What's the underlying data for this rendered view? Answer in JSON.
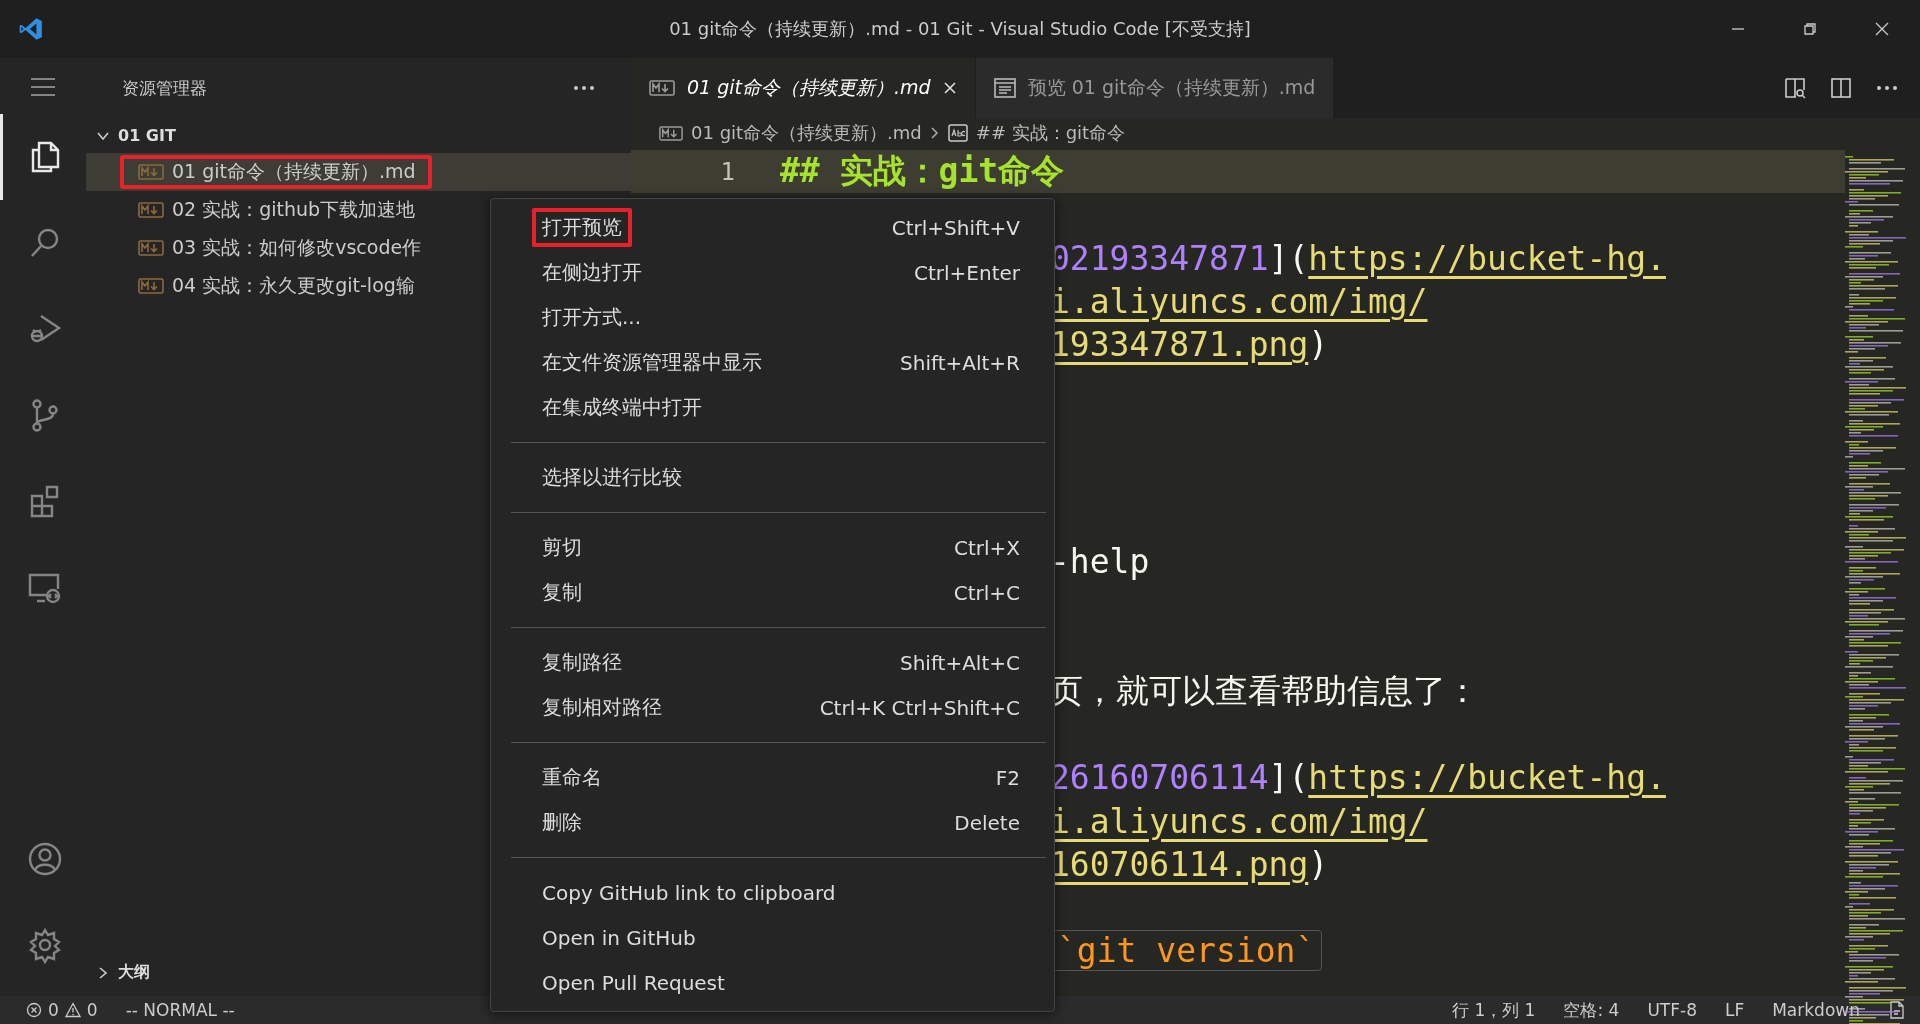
{
  "window": {
    "title": "01 git命令（持续更新）.md - 01 Git - Visual Studio Code [不受支持]"
  },
  "activity_bar": {
    "top": [
      {
        "kind": "files",
        "selected": true
      },
      {
        "kind": "search",
        "selected": false
      },
      {
        "kind": "debug",
        "selected": false
      },
      {
        "kind": "source-control",
        "selected": false
      },
      {
        "kind": "extensions",
        "selected": false
      },
      {
        "kind": "remote",
        "selected": false
      }
    ],
    "bottom": [
      {
        "kind": "account",
        "selected": false
      },
      {
        "kind": "settings",
        "selected": false
      }
    ]
  },
  "sidebar": {
    "title": "资源管理器",
    "folder": {
      "name": "01 GIT",
      "expanded": true
    },
    "files": [
      {
        "name": "01 git命令（持续更新）.md",
        "selected": true,
        "marked": true
      },
      {
        "name": "02 实战：github下载加速地",
        "selected": false,
        "marked": false
      },
      {
        "name": "03 实战：如何修改vscode作",
        "selected": false,
        "marked": false
      },
      {
        "name": "04 实战：永久更改git-log输",
        "selected": false,
        "marked": false
      }
    ],
    "outline": {
      "name": "大纲",
      "expanded": false
    }
  },
  "tabs": [
    {
      "label": "01 git命令（持续更新）.md",
      "kind": "markdown",
      "selected": true
    },
    {
      "label": "预览 01 git命令（持续更新）.md",
      "kind": "preview",
      "selected": false
    }
  ],
  "breadcrumb": [
    {
      "label": "01 git命令（持续更新）.md",
      "kind": "file"
    },
    {
      "label": "## 实战：git命令",
      "kind": "heading"
    }
  ],
  "editor": {
    "lines": [
      {
        "number": "1",
        "kind": "heading",
        "current": true,
        "segments": [
          {
            "kind": "heading",
            "text": "## 实战：git命令"
          }
        ]
      },
      {
        "kind": "blank"
      },
      {
        "kind": "text",
        "segments": [
          {
            "kind": "number",
            "text": "02193347871"
          },
          {
            "kind": "punct",
            "text": "]("
          },
          {
            "kind": "link",
            "text": "https://bucket-hg."
          }
        ]
      },
      {
        "kind": "text",
        "segments": [
          {
            "kind": "link",
            "text": "i.aliyuncs.com/img/"
          }
        ]
      },
      {
        "kind": "text",
        "segments": [
          {
            "kind": "link",
            "text": "193347871.png"
          },
          {
            "kind": "punct",
            "text": ")"
          }
        ]
      },
      {
        "kind": "blank"
      },
      {
        "kind": "blank"
      },
      {
        "kind": "blank"
      },
      {
        "kind": "blank"
      },
      {
        "kind": "text",
        "segments": [
          {
            "kind": "plain",
            "text": "-help"
          }
        ]
      },
      {
        "kind": "blank"
      },
      {
        "kind": "blank"
      },
      {
        "kind": "text",
        "segments": [
          {
            "kind": "prose",
            "text": "页，就可以查看帮助信息了："
          }
        ]
      },
      {
        "kind": "blank"
      },
      {
        "kind": "text",
        "segments": [
          {
            "kind": "number",
            "text": "26160706114"
          },
          {
            "kind": "punct",
            "text": "]("
          },
          {
            "kind": "link",
            "text": "https://bucket-hg."
          }
        ]
      },
      {
        "kind": "text",
        "segments": [
          {
            "kind": "link",
            "text": "i.aliyuncs.com/img/"
          }
        ]
      },
      {
        "kind": "text",
        "segments": [
          {
            "kind": "link",
            "text": "160706114.png"
          },
          {
            "kind": "punct",
            "text": ")"
          }
        ]
      },
      {
        "kind": "blank"
      },
      {
        "kind": "text",
        "segments": [
          {
            "kind": "code",
            "text": "`git version`"
          }
        ]
      }
    ]
  },
  "context_menu": {
    "groups": [
      [
        {
          "label": "打开预览",
          "shortcut": "Ctrl+Shift+V",
          "marked": true
        },
        {
          "label": "在侧边打开",
          "shortcut": "Ctrl+Enter",
          "marked": false
        },
        {
          "label": "打开方式...",
          "marked": false
        },
        {
          "label": "在文件资源管理器中显示",
          "shortcut": "Shift+Alt+R",
          "marked": false
        },
        {
          "label": "在集成终端中打开",
          "marked": false
        }
      ],
      [
        {
          "label": "选择以进行比较",
          "marked": false
        }
      ],
      [
        {
          "label": "剪切",
          "shortcut": "Ctrl+X",
          "marked": false
        },
        {
          "label": "复制",
          "shortcut": "Ctrl+C",
          "marked": false
        }
      ],
      [
        {
          "label": "复制路径",
          "shortcut": "Shift+Alt+C",
          "marked": false
        },
        {
          "label": "复制相对路径",
          "shortcut": "Ctrl+K Ctrl+Shift+C",
          "marked": false
        }
      ],
      [
        {
          "label": "重命名",
          "shortcut": "F2",
          "marked": false
        },
        {
          "label": "删除",
          "shortcut": "Delete",
          "marked": false
        }
      ],
      [
        {
          "label": "Copy GitHub link to clipboard",
          "marked": false
        },
        {
          "label": "Open in GitHub",
          "marked": false
        },
        {
          "label": "Open Pull Request",
          "marked": false
        }
      ]
    ]
  },
  "status_bar": {
    "errors": "0",
    "warnings": "0",
    "mode": "-- NORMAL --",
    "right": [
      "行 1，列 1",
      "空格: 4",
      "UTF-8",
      "LF",
      "Markdown"
    ]
  }
}
